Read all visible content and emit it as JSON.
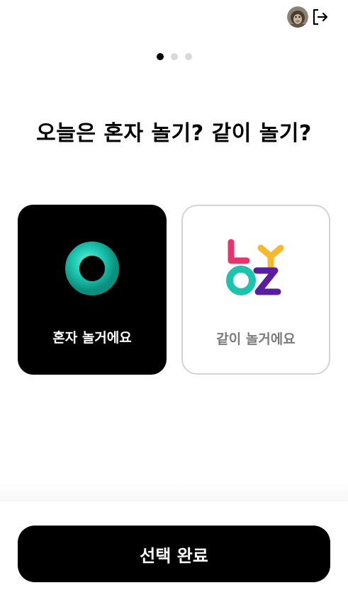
{
  "header": {
    "avatar_icon": "user-avatar-icon",
    "logout_icon": "logout-icon"
  },
  "pager": {
    "total": 3,
    "active": 1
  },
  "main": {
    "title": "오늘은 혼자 놀기? 같이 놀기?",
    "options": [
      {
        "label": "혼자 놀거에요",
        "icon": "ring-icon",
        "selected": true
      },
      {
        "label": "같이 놀거에요",
        "icon": "letters-logo-icon",
        "selected": false
      }
    ]
  },
  "footer": {
    "submit_label": "선택 완료"
  },
  "colors": {
    "primary": "#000000",
    "ring": "#1cc8b0",
    "selected_text": "#ffffff",
    "unselected_text": "#7b7b7b",
    "border": "#d4d4d4"
  }
}
